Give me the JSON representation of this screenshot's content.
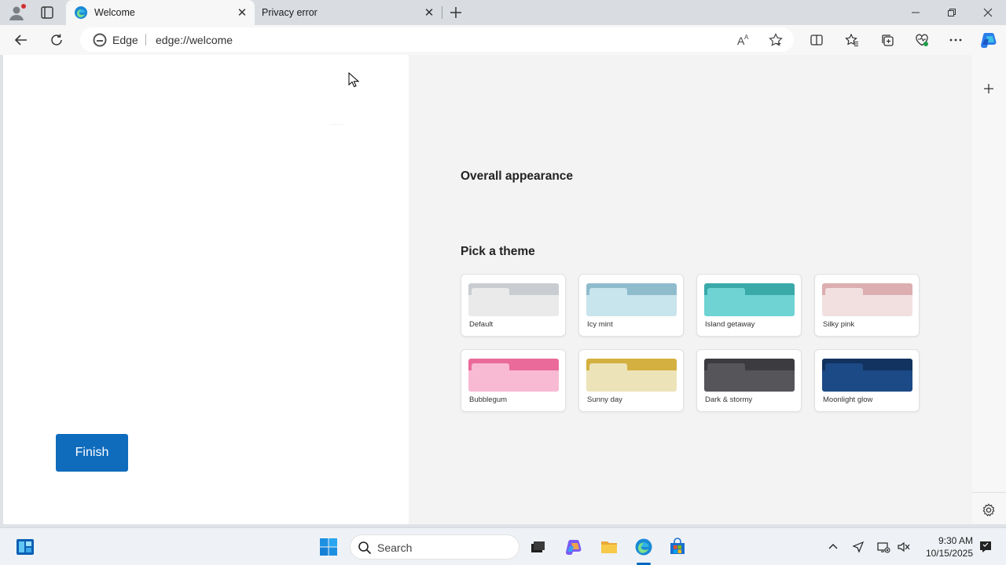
{
  "browser": {
    "tabs": [
      {
        "title": "Welcome",
        "active": true,
        "favicon": "edge-icon"
      },
      {
        "title": "Privacy error",
        "active": false
      }
    ],
    "address": {
      "site_label": "Edge",
      "url": "edge://welcome"
    }
  },
  "welcome": {
    "finish_label": "Finish",
    "overall_heading": "Overall appearance",
    "pick_heading": "Pick a theme",
    "themes": [
      {
        "label": "Default",
        "top": "#c9ccd0",
        "body": "#eaeaea"
      },
      {
        "label": "Icy mint",
        "top": "#8fbccd",
        "body": "#c8e4ec"
      },
      {
        "label": "Island getaway",
        "top": "#3aa9a9",
        "body": "#6fd3d3"
      },
      {
        "label": "Silky pink",
        "top": "#dcaeb0",
        "body": "#f2e0e0"
      },
      {
        "label": "Bubblegum",
        "top": "#ea6a9a",
        "body": "#f8bad2"
      },
      {
        "label": "Sunny day",
        "top": "#d4b040",
        "body": "#ece3b8"
      },
      {
        "label": "Dark & stormy",
        "top": "#3b3b40",
        "body": "#55555a"
      },
      {
        "label": "Moonlight glow",
        "top": "#12335f",
        "body": "#1c4a86"
      }
    ]
  },
  "taskbar": {
    "search_label": "Search",
    "time": "9:30 AM",
    "date": "10/15/2025"
  },
  "colors": {
    "accent": "#0f6cbd"
  }
}
